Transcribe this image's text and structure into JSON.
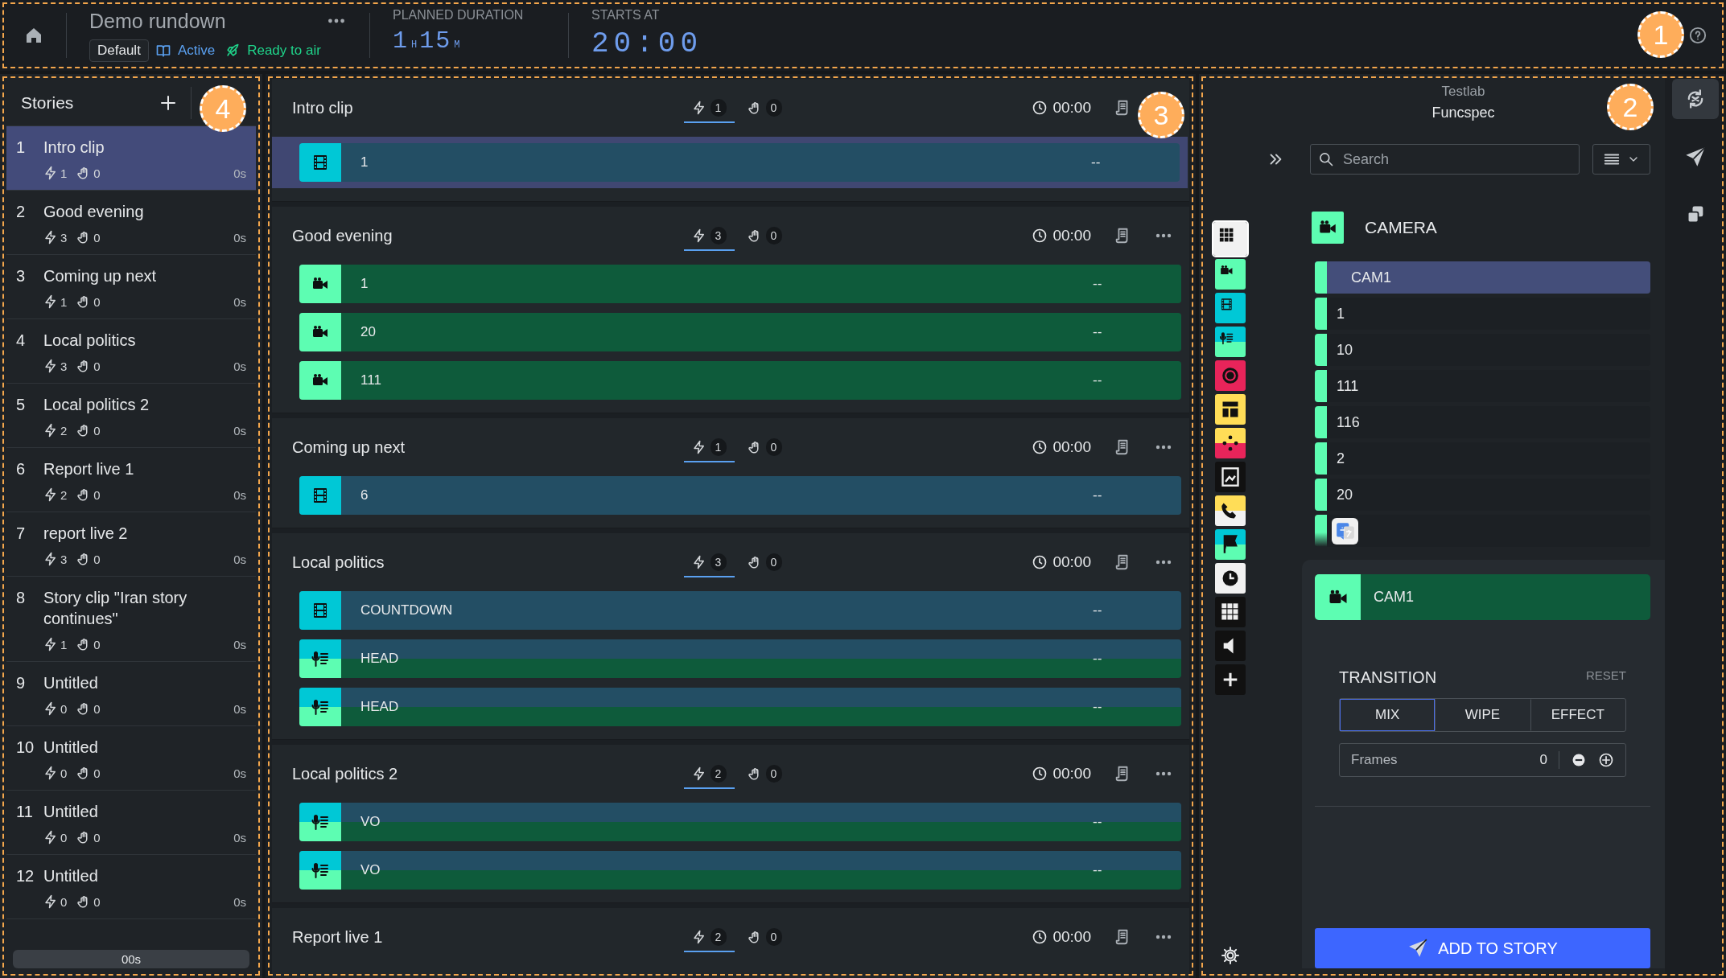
{
  "top_bar": {
    "title": "Demo rundown",
    "template": "Default",
    "status": "Active",
    "readiness": "Ready to air",
    "planned_duration": {
      "label": "PLANNED DURATION",
      "hours": "1",
      "hours_unit": "H",
      "minutes": "15",
      "minutes_unit": "M"
    },
    "starts_at": {
      "label": "STARTS AT",
      "time": "20:00"
    },
    "callout": "1"
  },
  "stories": {
    "title": "Stories",
    "items": [
      {
        "number": "1",
        "title": "Intro clip",
        "triggers": "1",
        "manual": "0",
        "duration": "0s",
        "selected": true
      },
      {
        "number": "2",
        "title": "Good evening",
        "triggers": "3",
        "manual": "0",
        "duration": "0s",
        "selected": false
      },
      {
        "number": "3",
        "title": "Coming up next",
        "triggers": "1",
        "manual": "0",
        "duration": "0s",
        "selected": false
      },
      {
        "number": "4",
        "title": "Local politics",
        "triggers": "3",
        "manual": "0",
        "duration": "0s",
        "selected": false
      },
      {
        "number": "5",
        "title": "Local politics 2",
        "triggers": "2",
        "manual": "0",
        "duration": "0s",
        "selected": false
      },
      {
        "number": "6",
        "title": "Report live 1",
        "triggers": "2",
        "manual": "0",
        "duration": "0s",
        "selected": false
      },
      {
        "number": "7",
        "title": "report live 2",
        "triggers": "3",
        "manual": "0",
        "duration": "0s",
        "selected": false
      },
      {
        "number": "8",
        "title": "Story clip \"Iran story continues\"",
        "triggers": "1",
        "manual": "0",
        "duration": "0s",
        "selected": false
      },
      {
        "number": "9",
        "title": "Untitled",
        "triggers": "0",
        "manual": "0",
        "duration": "0s",
        "selected": false
      },
      {
        "number": "10",
        "title": "Untitled",
        "triggers": "0",
        "manual": "0",
        "duration": "0s",
        "selected": false
      },
      {
        "number": "11",
        "title": "Untitled",
        "triggers": "0",
        "manual": "0",
        "duration": "0s",
        "selected": false
      },
      {
        "number": "12",
        "title": "Untitled",
        "triggers": "0",
        "manual": "0",
        "duration": "0s",
        "selected": false
      }
    ],
    "total": "00s",
    "callout": "4"
  },
  "rundown": {
    "stories": [
      {
        "title": "Intro clip",
        "triggers": "1",
        "manual": "0",
        "time": "00:00",
        "menu_visible": false,
        "elements": [
          {
            "kind": "clip",
            "label": "1",
            "duration": "--",
            "selected": true
          }
        ]
      },
      {
        "title": "Good evening",
        "triggers": "3",
        "manual": "0",
        "time": "00:00",
        "menu_visible": true,
        "elements": [
          {
            "kind": "camera",
            "label": "1",
            "duration": "--",
            "selected": false
          },
          {
            "kind": "camera",
            "label": "20",
            "duration": "--",
            "selected": false
          },
          {
            "kind": "camera",
            "label": "111",
            "duration": "--",
            "selected": false
          }
        ]
      },
      {
        "title": "Coming up next",
        "triggers": "1",
        "manual": "0",
        "time": "00:00",
        "menu_visible": true,
        "elements": [
          {
            "kind": "clip",
            "label": "6",
            "duration": "--",
            "selected": false
          }
        ]
      },
      {
        "title": "Local politics",
        "triggers": "3",
        "manual": "0",
        "time": "00:00",
        "menu_visible": true,
        "elements": [
          {
            "kind": "clip",
            "label": "COUNTDOWN",
            "duration": "--",
            "selected": false
          },
          {
            "kind": "voiceover",
            "label": "HEAD",
            "duration": "--",
            "selected": false
          },
          {
            "kind": "voiceover",
            "label": "HEAD",
            "duration": "--",
            "selected": false
          }
        ]
      },
      {
        "title": "Local politics 2",
        "triggers": "2",
        "manual": "0",
        "time": "00:00",
        "menu_visible": true,
        "elements": [
          {
            "kind": "voiceover",
            "label": "VO",
            "duration": "--",
            "selected": false
          },
          {
            "kind": "voiceover",
            "label": "VO",
            "duration": "--",
            "selected": false
          }
        ]
      },
      {
        "title": "Report live 1",
        "triggers": "2",
        "manual": "0",
        "time": "00:00",
        "menu_visible": true
      }
    ],
    "callout": "3"
  },
  "library": {
    "workspace": "Testlab",
    "project": "Funcspec",
    "search": {
      "placeholder": "Search"
    },
    "categories": [
      {
        "kind": "all",
        "selected": true
      },
      {
        "kind": "camera",
        "selected": false
      },
      {
        "kind": "clip",
        "selected": false
      },
      {
        "kind": "voiceover",
        "selected": false
      },
      {
        "kind": "record",
        "selected": false
      },
      {
        "kind": "layout",
        "selected": false
      },
      {
        "kind": "controller",
        "selected": false
      },
      {
        "kind": "image",
        "selected": false
      },
      {
        "kind": "phone",
        "selected": false
      },
      {
        "kind": "flag",
        "selected": false
      },
      {
        "kind": "clock",
        "selected": false
      },
      {
        "kind": "grid",
        "selected": false
      },
      {
        "kind": "audio",
        "selected": false
      },
      {
        "kind": "add",
        "selected": false
      }
    ],
    "category_title": "CAMERA",
    "items": [
      {
        "kind": "source",
        "label": "CAM1",
        "selected": true
      },
      {
        "kind": "source",
        "label": "1",
        "selected": false
      },
      {
        "kind": "source",
        "label": "10",
        "selected": false
      },
      {
        "kind": "source",
        "label": "111",
        "selected": false
      },
      {
        "kind": "source",
        "label": "116",
        "selected": false
      },
      {
        "kind": "source",
        "label": "2",
        "selected": false
      },
      {
        "kind": "source",
        "label": "20",
        "selected": false
      },
      {
        "kind": "app",
        "selected": false
      }
    ],
    "preview": {
      "kind": "camera",
      "label": "CAM1"
    },
    "transition": {
      "title": "TRANSITION",
      "reset": "RESET",
      "tabs": [
        {
          "label": "MIX",
          "selected": true
        },
        {
          "label": "WIPE",
          "selected": false
        },
        {
          "label": "EFFECT",
          "selected": false
        }
      ],
      "frames": {
        "label": "Frames",
        "value": "0"
      }
    },
    "add_button": "ADD TO STORY",
    "side_tools": [
      {
        "kind": "sync",
        "selected": true
      },
      {
        "kind": "send",
        "selected": false
      },
      {
        "kind": "copy",
        "selected": false
      }
    ],
    "callout": "2"
  }
}
